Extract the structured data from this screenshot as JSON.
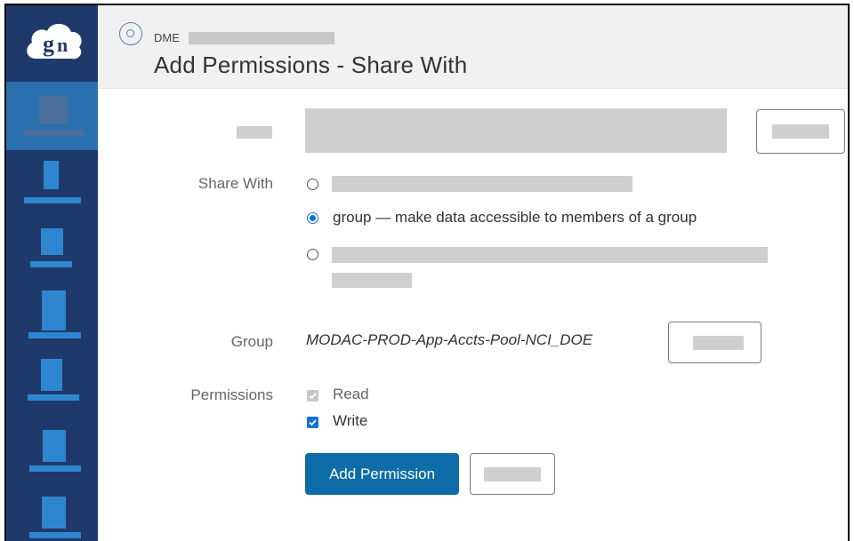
{
  "header": {
    "breadcrumb": "DME",
    "title": "Add Permissions - Share With"
  },
  "form": {
    "share_with_label": "Share With",
    "options": [
      {
        "text": "",
        "selected": false
      },
      {
        "text": "group — make data accessible to members of a group",
        "selected": true
      },
      {
        "text": "",
        "selected": false
      }
    ],
    "group_label": "Group",
    "group_value": "MODAC-PROD-App-Accts-Pool-NCI_DOE",
    "permissions_label": "Permissions",
    "permissions": [
      {
        "label": "Read",
        "checked": true,
        "disabled": true
      },
      {
        "label": "Write",
        "checked": true,
        "disabled": false
      }
    ],
    "add_button_label": "Add Permission"
  },
  "colors": {
    "sidebar": "#1f3a6a",
    "sidebar_active": "#2a6fae",
    "primary": "#0e6ca8",
    "checkbox": "#1570d8"
  }
}
